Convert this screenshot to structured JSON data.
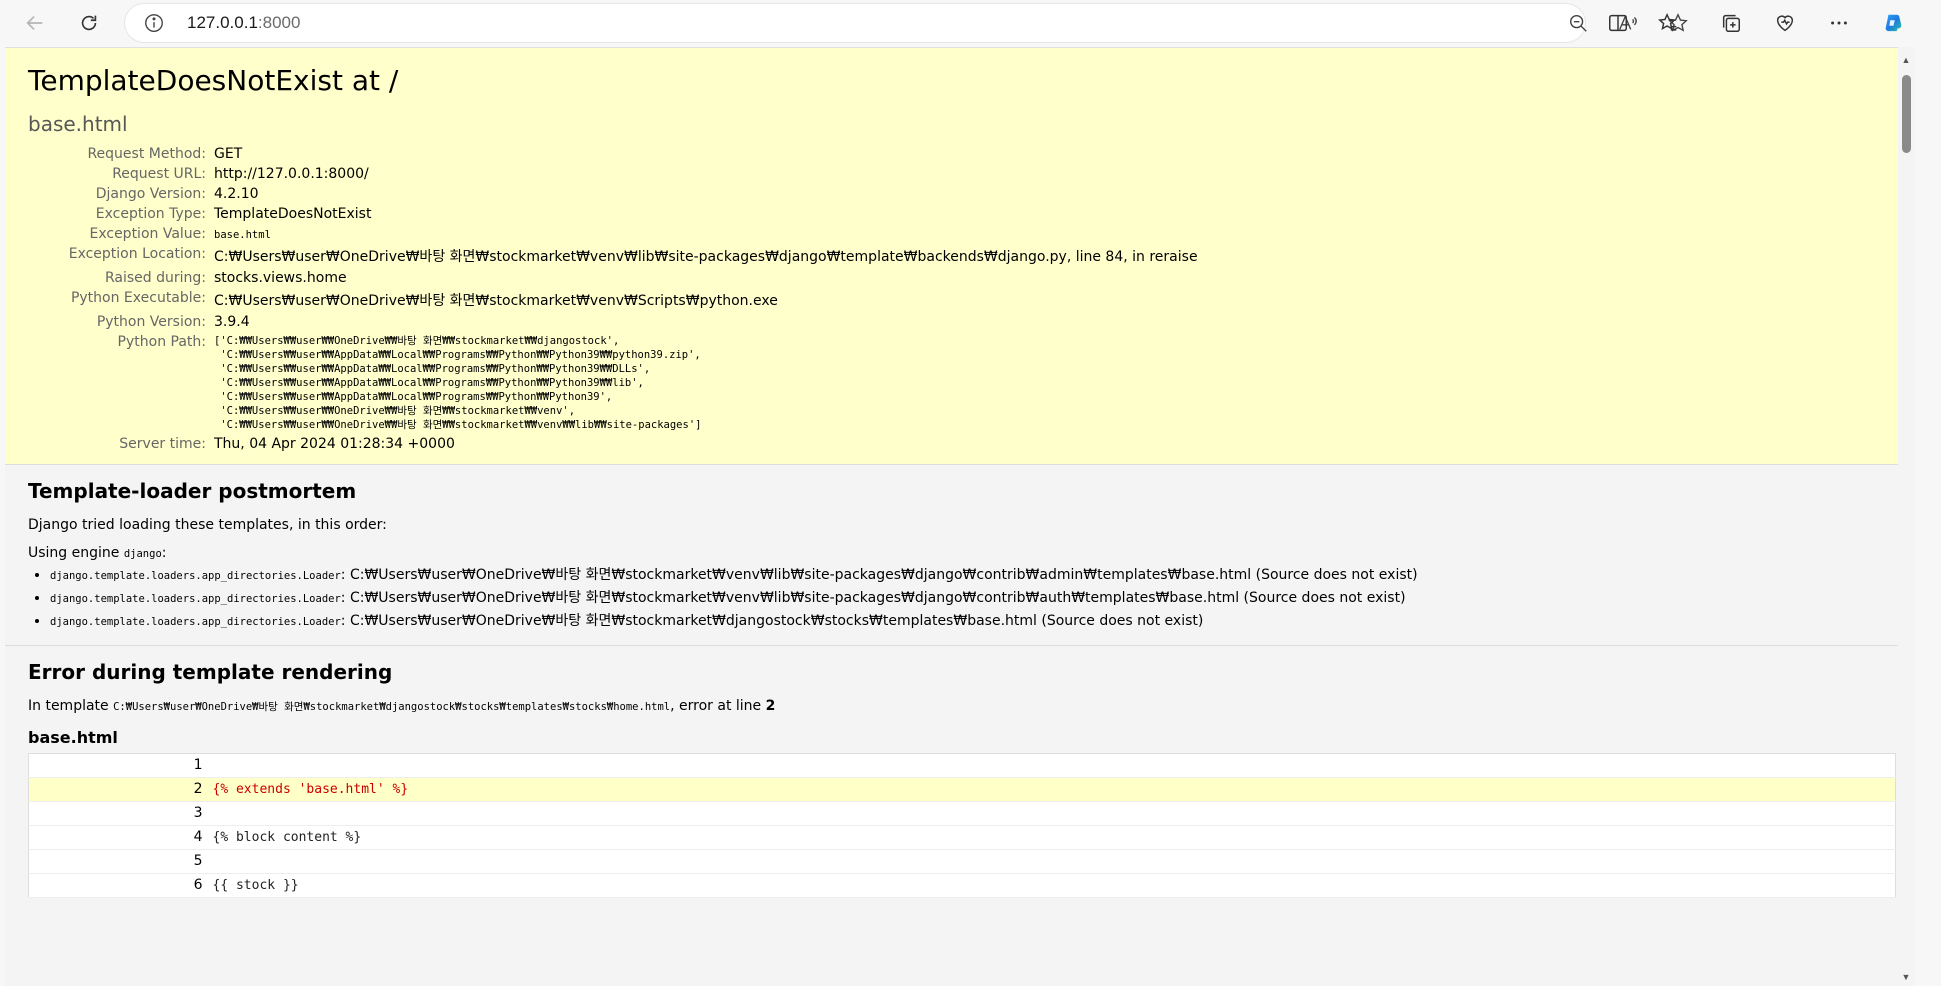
{
  "browser": {
    "address_host": "127.0.0.1",
    "address_port": ":8000"
  },
  "summary": {
    "title": "TemplateDoesNotExist at /",
    "exception_value_heading": "base.html",
    "rows": [
      {
        "label": "Request Method:",
        "value": "GET"
      },
      {
        "label": "Request URL:",
        "value": "http://127.0.0.1:8000/"
      },
      {
        "label": "Django Version:",
        "value": "4.2.10"
      },
      {
        "label": "Exception Type:",
        "value": "TemplateDoesNotExist"
      },
      {
        "label": "Exception Value:",
        "value": "base.html"
      },
      {
        "label": "Exception Location:",
        "value": "C:₩Users₩user₩OneDrive₩바탕 화면₩stockmarket₩venv₩lib₩site-packages₩django₩template₩backends₩django.py, line 84, in reraise"
      },
      {
        "label": "Raised during:",
        "value": "stocks.views.home"
      },
      {
        "label": "Python Executable:",
        "value": "C:₩Users₩user₩OneDrive₩바탕 화면₩stockmarket₩venv₩Scripts₩python.exe"
      },
      {
        "label": "Python Version:",
        "value": "3.9.4"
      },
      {
        "label": "Python Path:",
        "value": "['C:₩₩Users₩₩user₩₩OneDrive₩₩바탕 화면₩₩stockmarket₩₩djangostock',\n 'C:₩₩Users₩₩user₩₩AppData₩₩Local₩₩Programs₩₩Python₩₩Python39₩₩python39.zip',\n 'C:₩₩Users₩₩user₩₩AppData₩₩Local₩₩Programs₩₩Python₩₩Python39₩₩DLLs',\n 'C:₩₩Users₩₩user₩₩AppData₩₩Local₩₩Programs₩₩Python₩₩Python39₩₩lib',\n 'C:₩₩Users₩₩user₩₩AppData₩₩Local₩₩Programs₩₩Python₩₩Python39',\n 'C:₩₩Users₩₩user₩₩OneDrive₩₩바탕 화면₩₩stockmarket₩₩venv',\n 'C:₩₩Users₩₩user₩₩OneDrive₩₩바탕 화면₩₩stockmarket₩₩venv₩₩lib₩₩site-packages']"
      },
      {
        "label": "Server time:",
        "value": "Thu, 04 Apr 2024 01:28:34 +0000"
      }
    ]
  },
  "postmortem": {
    "heading": "Template-loader postmortem",
    "intro": "Django tried loading these templates, in this order:",
    "engine_prefix": "Using engine ",
    "engine_name": "django",
    "engine_suffix": ":",
    "items": [
      {
        "loader": "django.template.loaders.app_directories.Loader",
        "path": ": C:₩Users₩user₩OneDrive₩바탕 화면₩stockmarket₩venv₩lib₩site-packages₩django₩contrib₩admin₩templates₩base.html (Source does not exist)"
      },
      {
        "loader": "django.template.loaders.app_directories.Loader",
        "path": ": C:₩Users₩user₩OneDrive₩바탕 화면₩stockmarket₩venv₩lib₩site-packages₩django₩contrib₩auth₩templates₩base.html (Source does not exist)"
      },
      {
        "loader": "django.template.loaders.app_directories.Loader",
        "path": ": C:₩Users₩user₩OneDrive₩바탕 화면₩stockmarket₩djangostock₩stocks₩templates₩base.html (Source does not exist)"
      }
    ]
  },
  "render": {
    "heading": "Error during template rendering",
    "in_template_prefix": "In template ",
    "template_path": "C:₩Users₩user₩OneDrive₩바탕 화면₩stockmarket₩djangostock₩stocks₩templates₩stocks₩home.html",
    "error_at_line_text": ", error at line ",
    "error_line": "2",
    "source_title": "base.html",
    "lines": [
      {
        "n": "1",
        "code": "",
        "error": false
      },
      {
        "n": "2",
        "code": "{% extends 'base.html' %}",
        "error": true
      },
      {
        "n": "3",
        "code": "",
        "error": false
      },
      {
        "n": "4",
        "code": "{% block content %}",
        "error": false
      },
      {
        "n": "5",
        "code": "",
        "error": false
      },
      {
        "n": "6",
        "code": "{{ stock }}",
        "error": false
      }
    ]
  }
}
